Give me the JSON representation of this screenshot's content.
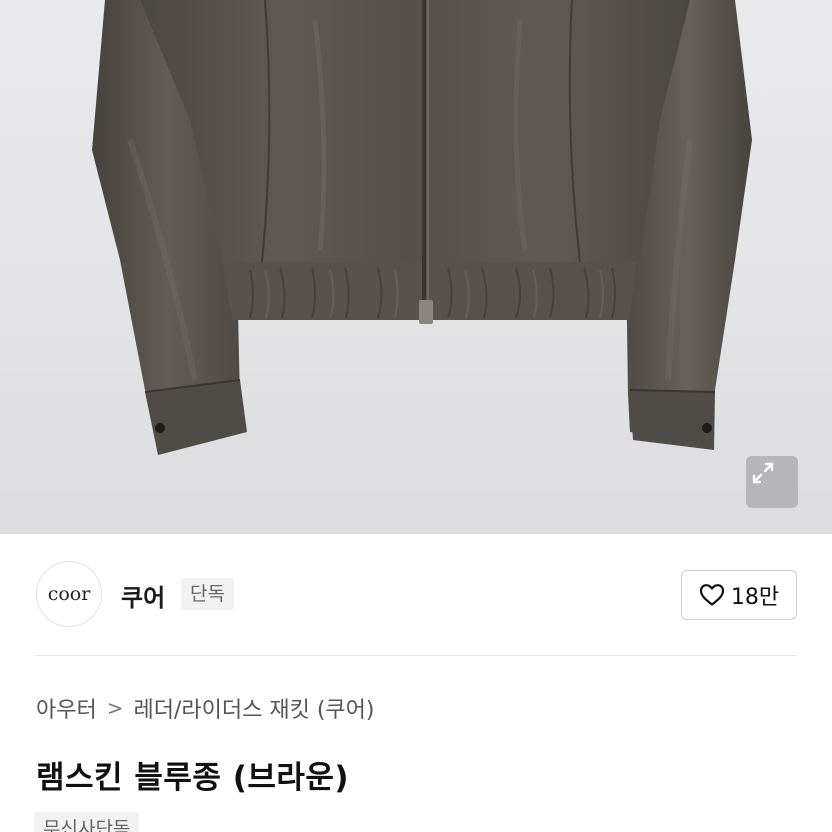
{
  "brand": {
    "logo_text": "coor",
    "name": "쿠어",
    "badge": "단독"
  },
  "like": {
    "icon": "heart-outline-icon",
    "count": "18만"
  },
  "breadcrumb": {
    "category": "아우터",
    "separator": ">",
    "subcategory": "레더/라이더스 재킷 (쿠어)"
  },
  "product": {
    "title": "램스킨 블루종 (브라운)",
    "badge": "무신사단독"
  },
  "image": {
    "expand_icon": "expand-arrows-icon",
    "jacket_color": "#5b5650",
    "background_color": "#e6e6e9"
  }
}
